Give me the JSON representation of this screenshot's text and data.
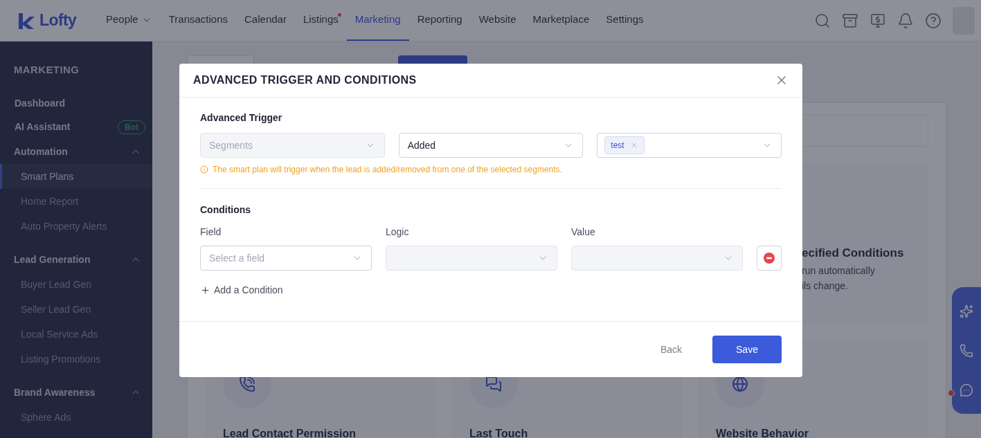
{
  "logo": {
    "text": "Lofty"
  },
  "nav": [
    {
      "label": "People",
      "dropdown": true,
      "dot": false,
      "selected": false
    },
    {
      "label": "Transactions",
      "dropdown": false,
      "dot": false,
      "selected": false
    },
    {
      "label": "Calendar",
      "dropdown": false,
      "dot": false,
      "selected": false
    },
    {
      "label": "Listings",
      "dropdown": false,
      "dot": true,
      "selected": false
    },
    {
      "label": "Marketing",
      "dropdown": false,
      "dot": false,
      "selected": true
    },
    {
      "label": "Reporting",
      "dropdown": false,
      "dot": false,
      "selected": false
    },
    {
      "label": "Website",
      "dropdown": false,
      "dot": false,
      "selected": false
    },
    {
      "label": "Marketplace",
      "dropdown": false,
      "dot": false,
      "selected": false
    },
    {
      "label": "Settings",
      "dropdown": false,
      "dot": false,
      "selected": false
    }
  ],
  "sidebar": {
    "title": "MARKETING",
    "sections": [
      {
        "kind": "link",
        "label": "Dashboard"
      },
      {
        "kind": "link",
        "label": "AI Assistant",
        "badge": "Bot"
      },
      {
        "kind": "group",
        "label": "Automation",
        "expanded": true,
        "children": [
          {
            "label": "Smart Plans",
            "selected": true
          },
          {
            "label": "Home Report",
            "selected": false
          },
          {
            "label": "Auto Property Alerts",
            "selected": false
          }
        ]
      },
      {
        "kind": "group",
        "label": "Lead Generation",
        "expanded": true,
        "children": [
          {
            "label": "Buyer Lead Gen",
            "selected": false
          },
          {
            "label": "Seller Lead Gen",
            "selected": false
          },
          {
            "label": "Local Service Ads",
            "selected": false
          },
          {
            "label": "Listing Promotions",
            "selected": false
          }
        ]
      },
      {
        "kind": "group",
        "label": "Brand Awareness",
        "expanded": true,
        "children": [
          {
            "label": "Sphere Ads",
            "selected": false
          }
        ]
      }
    ]
  },
  "page": {
    "feature_card": {
      "title": "ecified Conditions",
      "description": [
        "run automatically",
        "ils change."
      ]
    },
    "trigger_cards": [
      {
        "kind": "phone",
        "title": "Lead Contact Permission"
      },
      {
        "kind": "chat",
        "title": "Last Touch"
      },
      {
        "kind": "globe",
        "title": "Website Behavior"
      }
    ]
  },
  "modal": {
    "title": "ADVANCED TRIGGER AND CONDITIONS",
    "advanced_trigger": {
      "label": "Advanced Trigger",
      "source": {
        "placeholder": "Segments",
        "disabled": true
      },
      "action": {
        "value": "Added",
        "disabled": false
      },
      "segments": {
        "tags": [
          "test"
        ],
        "disabled": false
      },
      "hint": "The smart plan will trigger when the lead is added/removed from one of the selected segments."
    },
    "conditions": {
      "label": "Conditions",
      "columns": [
        "Field",
        "Logic",
        "Value"
      ],
      "rows": [
        {
          "field": {
            "placeholder": "Select a field",
            "disabled": false
          },
          "logic": {
            "disabled": true
          },
          "value": {
            "disabled": true
          }
        }
      ],
      "add_label": "Add a Condition"
    },
    "buttons": {
      "back": "Back",
      "save": "Save"
    }
  }
}
